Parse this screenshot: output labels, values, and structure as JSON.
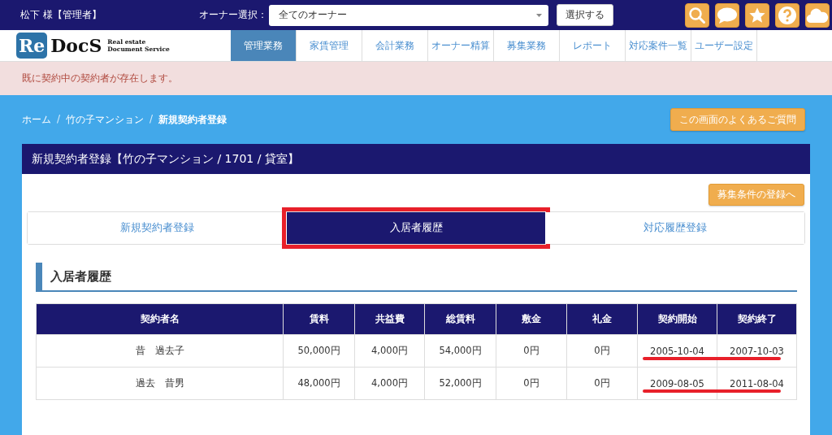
{
  "top_bar": {
    "user": "松下 様【管理者】",
    "owner_label": "オーナー選択：",
    "owner_select": {
      "value": "全てのオーナー"
    },
    "select_button": "選択する"
  },
  "toolbar_icons": [
    {
      "kind": "search"
    },
    {
      "kind": "chat"
    },
    {
      "kind": "star"
    },
    {
      "kind": "help"
    },
    {
      "kind": "cloud"
    }
  ],
  "logo": {
    "mark": "Re",
    "name": "DocS",
    "tagline_1": "Real estate",
    "tagline_2": "Document Service"
  },
  "nav": [
    {
      "label": "管理業務",
      "selected": true
    },
    {
      "label": "家賃管理",
      "selected": false
    },
    {
      "label": "会計業務",
      "selected": false
    },
    {
      "label": "オーナー精算",
      "selected": false
    },
    {
      "label": "募集業務",
      "selected": false
    },
    {
      "label": "レポート",
      "selected": false
    },
    {
      "label": "対応案件一覧",
      "selected": false
    },
    {
      "label": "ユーザー設定",
      "selected": false
    }
  ],
  "alert": "既に契約中の契約者が存在します。",
  "breadcrumb": [
    {
      "label": "ホーム",
      "current": false
    },
    {
      "separator": "/",
      "label": "竹の子マンション",
      "current": false
    },
    {
      "separator": "/",
      "label": "新規契約者登録",
      "current": true
    }
  ],
  "faq_button": "この画面のよくあるご質問",
  "panel": {
    "title": "新規契約者登録【竹の子マンション / 1701 / 貸室】",
    "recruit_button": "募集条件の登録へ",
    "tabs": [
      {
        "label": "新規契約者登録",
        "selected": false,
        "highlighted": false
      },
      {
        "label": "入居者履歴",
        "selected": true,
        "highlighted": true
      },
      {
        "label": "対応履歴登録",
        "selected": false,
        "highlighted": false
      }
    ],
    "section_title": "入居者履歴",
    "table": {
      "columns": [
        "契約者名",
        "賃料",
        "共益費",
        "総賃料",
        "敷金",
        "礼金",
        "契約開始",
        "契約終了"
      ],
      "rows": [
        {
          "cells": [
            "昔　過去子",
            "50,000円",
            "4,000円",
            "54,000円",
            "0円",
            "0円",
            "2005-10-04",
            "2007-10-03"
          ],
          "dates_underlined": true
        },
        {
          "cells": [
            "過去　昔男",
            "48,000円",
            "4,000円",
            "52,000円",
            "0円",
            "0円",
            "2009-08-05",
            "2011-08-04"
          ],
          "dates_underlined": true
        }
      ]
    }
  }
}
